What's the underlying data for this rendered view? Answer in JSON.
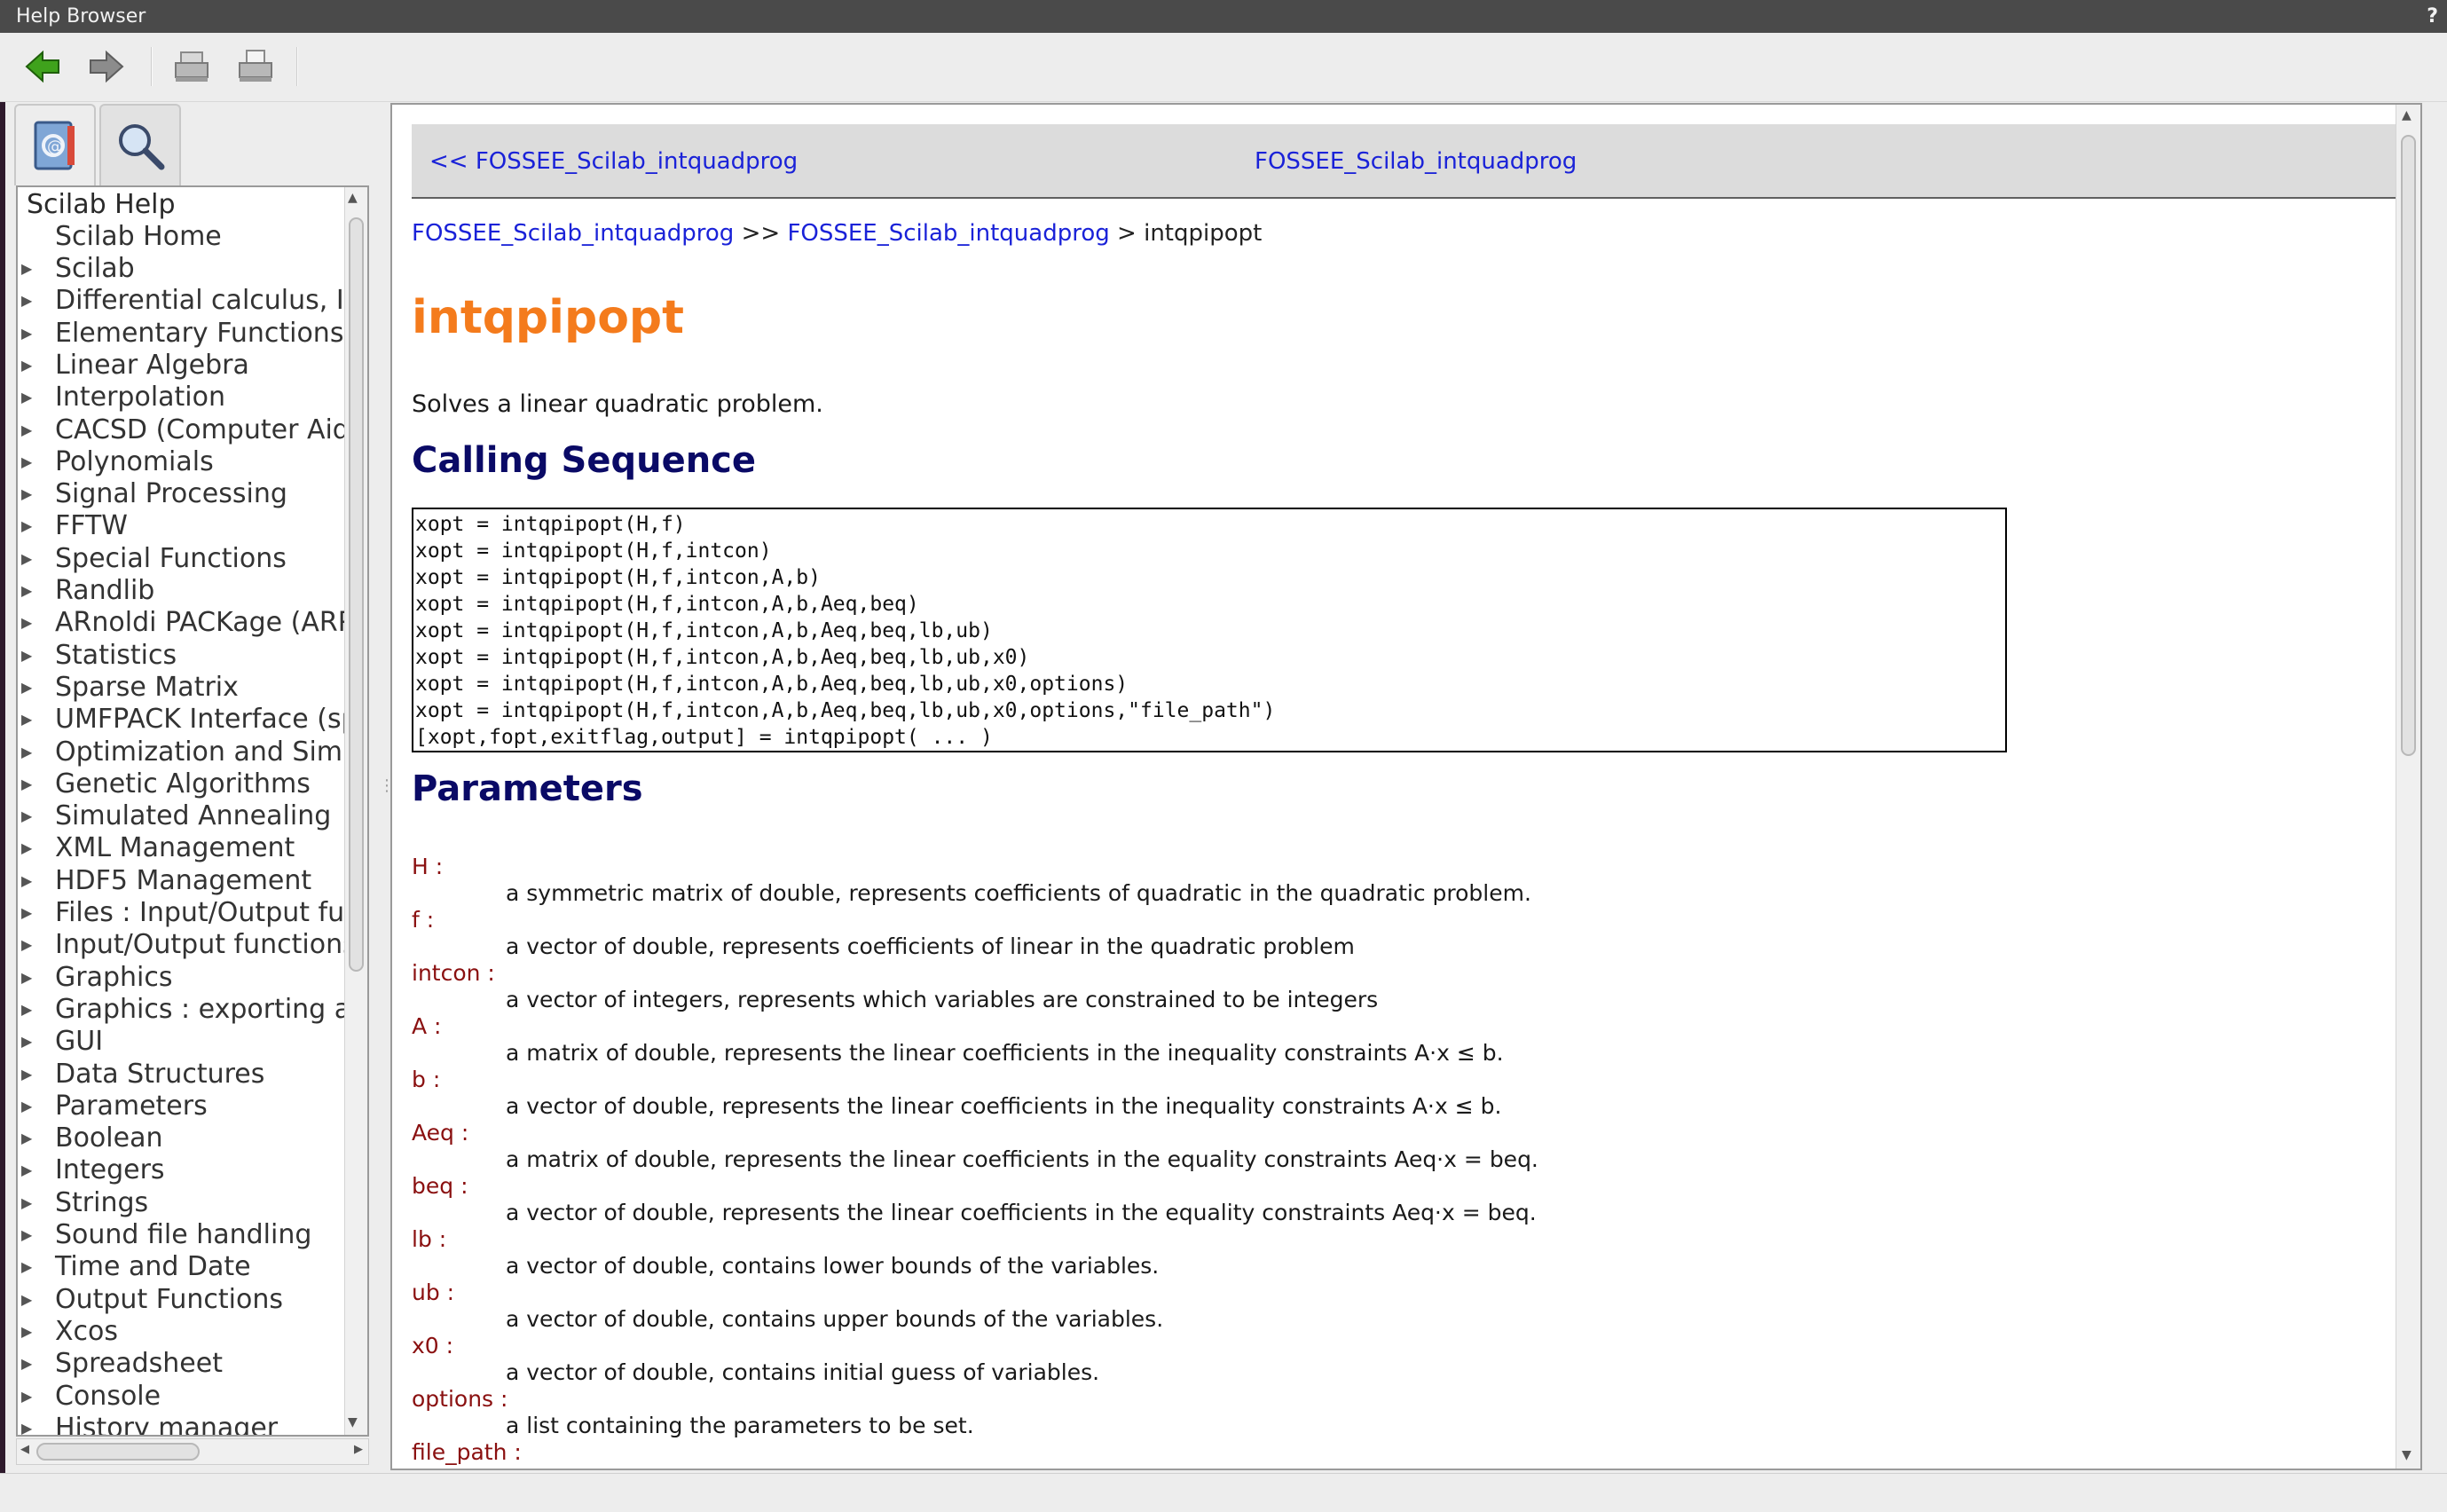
{
  "window": {
    "title": "Help Browser",
    "help_glyph": "?"
  },
  "toolbar": {
    "back_icon": "back-arrow-icon",
    "forward_icon": "forward-arrow-icon",
    "print_icon": "printer-icon",
    "page_setup_icon": "page-setup-icon"
  },
  "tabs": [
    {
      "icon": "help-book-icon",
      "active": true
    },
    {
      "icon": "search-magnifier-icon",
      "active": false
    }
  ],
  "tree": {
    "root": "Scilab Help",
    "home": "Scilab Home",
    "items": [
      "Scilab",
      "Differential calculus, Inte",
      "Elementary Functions",
      "Linear Algebra",
      "Interpolation",
      "CACSD (Computer Aidec",
      "Polynomials",
      "Signal Processing",
      "FFTW",
      "Special Functions",
      "Randlib",
      "ARnoldi PACKage (ARPAC",
      "Statistics",
      "Sparse Matrix",
      "UMFPACK Interface (spa",
      "Optimization and Simulat",
      "Genetic Algorithms",
      "Simulated Annealing",
      "XML Management",
      "HDF5 Management",
      "Files : Input/Output func",
      "Input/Output functions",
      "Graphics",
      "Graphics : exporting and",
      "GUI",
      "Data Structures",
      "Parameters",
      "Boolean",
      "Integers",
      "Strings",
      "Sound file handling",
      "Time and Date",
      "Output Functions",
      "Xcos",
      "Spreadsheet",
      "Console",
      "History manager"
    ]
  },
  "content": {
    "nav_prev": "<< FOSSEE_Scilab_intquadprog",
    "nav_up": "FOSSEE_Scilab_intquadprog",
    "breadcrumb": {
      "link1": "FOSSEE_Scilab_intquadprog",
      "sep1": " >> ",
      "link2": "FOSSEE_Scilab_intquadprog",
      "sep2": " > ",
      "current": "intqpipopt"
    },
    "title": "intqpipopt",
    "short_description": "Solves a linear quadratic problem.",
    "calling_sequence_heading": "Calling Sequence",
    "calling_sequence": [
      "xopt = intqpipopt(H,f)",
      "xopt = intqpipopt(H,f,intcon)",
      "xopt = intqpipopt(H,f,intcon,A,b)",
      "xopt = intqpipopt(H,f,intcon,A,b,Aeq,beq)",
      "xopt = intqpipopt(H,f,intcon,A,b,Aeq,beq,lb,ub)",
      "xopt = intqpipopt(H,f,intcon,A,b,Aeq,beq,lb,ub,x0)",
      "xopt = intqpipopt(H,f,intcon,A,b,Aeq,beq,lb,ub,x0,options)",
      "xopt = intqpipopt(H,f,intcon,A,b,Aeq,beq,lb,ub,x0,options,\"file_path\")",
      "[xopt,fopt,exitflag,output] = intqpipopt( ... )"
    ],
    "parameters_heading": "Parameters",
    "parameters": [
      {
        "name": "H :",
        "desc": "a symmetric matrix of double, represents coefficients of quadratic in the quadratic problem."
      },
      {
        "name": "f :",
        "desc": "a vector of double, represents coefficients of linear in the quadratic problem"
      },
      {
        "name": "intcon :",
        "desc": "a vector of integers, represents which variables are constrained to be integers"
      },
      {
        "name": "A :",
        "desc": "a matrix of double, represents the linear coefficients in the inequality constraints A⋅x ≤ b."
      },
      {
        "name": "b :",
        "desc": "a vector of double, represents the linear coefficients in the inequality constraints A⋅x ≤ b."
      },
      {
        "name": "Aeq :",
        "desc": "a matrix of double, represents the linear coefficients in the equality constraints Aeq⋅x = beq."
      },
      {
        "name": "beq :",
        "desc": "a vector of double, represents the linear coefficients in the equality constraints Aeq⋅x = beq."
      },
      {
        "name": "lb :",
        "desc": "a vector of double, contains lower bounds of the variables."
      },
      {
        "name": "ub :",
        "desc": "a vector of double, contains upper bounds of the variables."
      },
      {
        "name": "x0 :",
        "desc": "a vector of double, contains initial guess of variables."
      },
      {
        "name": "options :",
        "desc": "a list containing the parameters to be set."
      },
      {
        "name": "file_path :",
        "desc": ""
      }
    ]
  },
  "colors": {
    "title_orange": "#f47b1c",
    "heading_navy": "#0a0a66",
    "link_blue": "#1a22d8",
    "param_red": "#8a1010"
  }
}
